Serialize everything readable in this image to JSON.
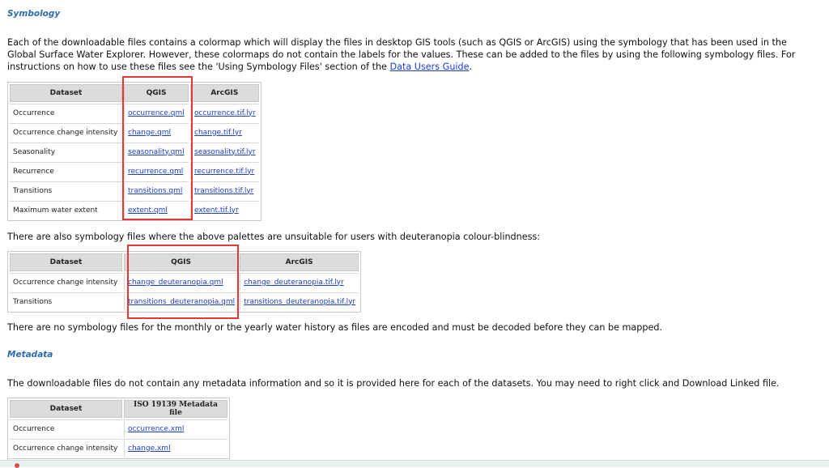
{
  "symbology": {
    "heading": "Symbology",
    "intro_text": "Each of the downloadable files contains a colormap which will display the files in desktop GIS tools (such as QGIS or ArcGIS) using the symbology that has been used in the Global Surface Water Explorer. However, these colormaps do not contain the labels for the values. These can be added to the files by using the following symbology files. For instructions on how to use these files see the 'Using Symbology Files' section of the ",
    "guide_link": "Data Users Guide",
    "intro_end": ".",
    "table": {
      "headers": [
        "Dataset",
        "QGIS",
        "ArcGIS"
      ],
      "rows": [
        {
          "dataset": "Occurrence",
          "qgis": "occurrence.qml",
          "arcgis": "occurrence.tif.lyr"
        },
        {
          "dataset": "Occurrence change intensity",
          "qgis": "change.qml",
          "arcgis": "change.tif.lyr"
        },
        {
          "dataset": "Seasonality",
          "qgis": "seasonality.qml",
          "arcgis": "seasonality.tif.lyr"
        },
        {
          "dataset": "Recurrence",
          "qgis": "recurrence.qml",
          "arcgis": "recurrence.tif.lyr"
        },
        {
          "dataset": "Transitions",
          "qgis": "transitions.qml",
          "arcgis": "transitions.tif.lyr"
        },
        {
          "dataset": "Maximum water extent",
          "qgis": "extent.qml",
          "arcgis": "extent.tif.lyr"
        }
      ]
    },
    "deut_text": "There are also symbology files where the above palettes are unsuitable for users with deuteranopia colour-blindness:",
    "deut_table": {
      "headers": [
        "Dataset",
        "QGIS",
        "ArcGIS"
      ],
      "rows": [
        {
          "dataset": "Occurrence change intensity",
          "qgis": "change_deuteranopia.qml",
          "arcgis": "change_deuteranopia.tif.lyr"
        },
        {
          "dataset": "Transitions",
          "qgis": "transitions_deuteranopia.qml",
          "arcgis": "transitions_deuteranopia.tif.lyr"
        }
      ]
    },
    "no_files_text": "There are no symbology files for the monthly or the yearly water history as files are encoded and must be decoded before they can be mapped."
  },
  "metadata": {
    "heading": "Metadata",
    "intro_text": "The downloadable files do not contain any metadata information and so it is provided here for each of the datasets. You may need to right click and Download Linked file.",
    "table": {
      "headers": [
        "Dataset",
        "ISO 19139 Metadata file"
      ],
      "rows": [
        {
          "dataset": "Occurrence",
          "file": "occurrence.xml"
        },
        {
          "dataset": "Occurrence change intensity",
          "file": "change.xml"
        }
      ]
    }
  },
  "colors": {
    "link": "#1a3fcf",
    "heading": "#2b6cb0",
    "highlight": "#e53935",
    "table_header": "#dcdcdc"
  }
}
